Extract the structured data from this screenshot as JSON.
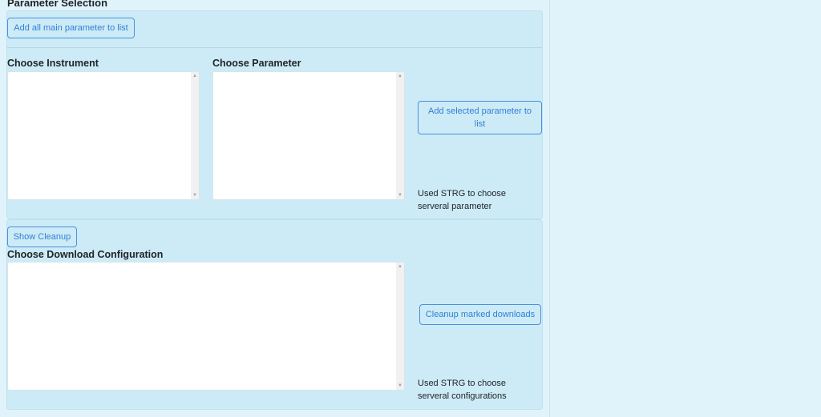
{
  "parameter_selection": {
    "title": "Parameter Selection",
    "add_all_button": "Add all main parameter to list",
    "instrument_label": "Choose Instrument",
    "parameter_label": "Choose Parameter",
    "add_selected_button": "Add selected parameter to list",
    "hint": "Used STRG to choose serveral parameter"
  },
  "cleanup": {
    "show_button": "Show Cleanup",
    "config_label": "Choose Download Configuration",
    "cleanup_button": "Cleanup marked downloads",
    "hint": "Used STRG to choose serveral configurations"
  },
  "icons": {
    "scroll_up": "▲",
    "scroll_down": "▼"
  },
  "colors": {
    "page_bg": "#e0f3fb",
    "card_bg": "#cdebf6",
    "button_border": "#4a90e2",
    "button_text": "#2f7fd8"
  }
}
